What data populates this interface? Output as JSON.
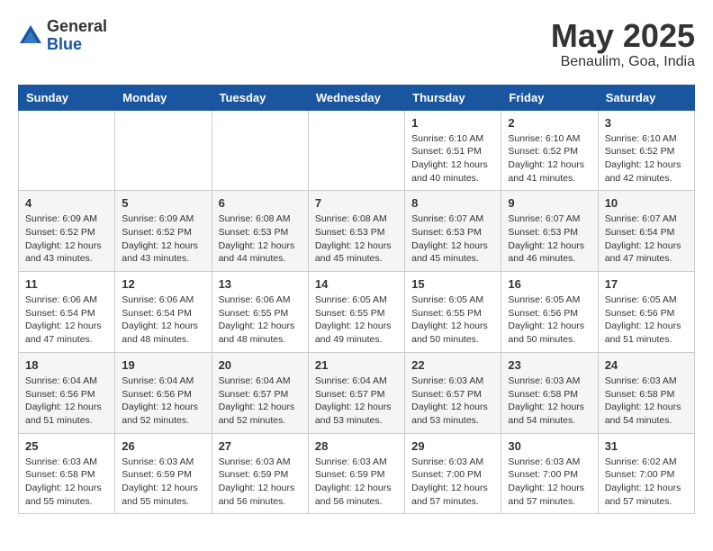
{
  "logo": {
    "general": "General",
    "blue": "Blue"
  },
  "title": {
    "month": "May 2025",
    "location": "Benaulim, Goa, India"
  },
  "headers": [
    "Sunday",
    "Monday",
    "Tuesday",
    "Wednesday",
    "Thursday",
    "Friday",
    "Saturday"
  ],
  "weeks": [
    [
      {
        "day": "",
        "info": ""
      },
      {
        "day": "",
        "info": ""
      },
      {
        "day": "",
        "info": ""
      },
      {
        "day": "",
        "info": ""
      },
      {
        "day": "1",
        "info": "Sunrise: 6:10 AM\nSunset: 6:51 PM\nDaylight: 12 hours\nand 40 minutes."
      },
      {
        "day": "2",
        "info": "Sunrise: 6:10 AM\nSunset: 6:52 PM\nDaylight: 12 hours\nand 41 minutes."
      },
      {
        "day": "3",
        "info": "Sunrise: 6:10 AM\nSunset: 6:52 PM\nDaylight: 12 hours\nand 42 minutes."
      }
    ],
    [
      {
        "day": "4",
        "info": "Sunrise: 6:09 AM\nSunset: 6:52 PM\nDaylight: 12 hours\nand 43 minutes."
      },
      {
        "day": "5",
        "info": "Sunrise: 6:09 AM\nSunset: 6:52 PM\nDaylight: 12 hours\nand 43 minutes."
      },
      {
        "day": "6",
        "info": "Sunrise: 6:08 AM\nSunset: 6:53 PM\nDaylight: 12 hours\nand 44 minutes."
      },
      {
        "day": "7",
        "info": "Sunrise: 6:08 AM\nSunset: 6:53 PM\nDaylight: 12 hours\nand 45 minutes."
      },
      {
        "day": "8",
        "info": "Sunrise: 6:07 AM\nSunset: 6:53 PM\nDaylight: 12 hours\nand 45 minutes."
      },
      {
        "day": "9",
        "info": "Sunrise: 6:07 AM\nSunset: 6:53 PM\nDaylight: 12 hours\nand 46 minutes."
      },
      {
        "day": "10",
        "info": "Sunrise: 6:07 AM\nSunset: 6:54 PM\nDaylight: 12 hours\nand 47 minutes."
      }
    ],
    [
      {
        "day": "11",
        "info": "Sunrise: 6:06 AM\nSunset: 6:54 PM\nDaylight: 12 hours\nand 47 minutes."
      },
      {
        "day": "12",
        "info": "Sunrise: 6:06 AM\nSunset: 6:54 PM\nDaylight: 12 hours\nand 48 minutes."
      },
      {
        "day": "13",
        "info": "Sunrise: 6:06 AM\nSunset: 6:55 PM\nDaylight: 12 hours\nand 48 minutes."
      },
      {
        "day": "14",
        "info": "Sunrise: 6:05 AM\nSunset: 6:55 PM\nDaylight: 12 hours\nand 49 minutes."
      },
      {
        "day": "15",
        "info": "Sunrise: 6:05 AM\nSunset: 6:55 PM\nDaylight: 12 hours\nand 50 minutes."
      },
      {
        "day": "16",
        "info": "Sunrise: 6:05 AM\nSunset: 6:56 PM\nDaylight: 12 hours\nand 50 minutes."
      },
      {
        "day": "17",
        "info": "Sunrise: 6:05 AM\nSunset: 6:56 PM\nDaylight: 12 hours\nand 51 minutes."
      }
    ],
    [
      {
        "day": "18",
        "info": "Sunrise: 6:04 AM\nSunset: 6:56 PM\nDaylight: 12 hours\nand 51 minutes."
      },
      {
        "day": "19",
        "info": "Sunrise: 6:04 AM\nSunset: 6:56 PM\nDaylight: 12 hours\nand 52 minutes."
      },
      {
        "day": "20",
        "info": "Sunrise: 6:04 AM\nSunset: 6:57 PM\nDaylight: 12 hours\nand 52 minutes."
      },
      {
        "day": "21",
        "info": "Sunrise: 6:04 AM\nSunset: 6:57 PM\nDaylight: 12 hours\nand 53 minutes."
      },
      {
        "day": "22",
        "info": "Sunrise: 6:03 AM\nSunset: 6:57 PM\nDaylight: 12 hours\nand 53 minutes."
      },
      {
        "day": "23",
        "info": "Sunrise: 6:03 AM\nSunset: 6:58 PM\nDaylight: 12 hours\nand 54 minutes."
      },
      {
        "day": "24",
        "info": "Sunrise: 6:03 AM\nSunset: 6:58 PM\nDaylight: 12 hours\nand 54 minutes."
      }
    ],
    [
      {
        "day": "25",
        "info": "Sunrise: 6:03 AM\nSunset: 6:58 PM\nDaylight: 12 hours\nand 55 minutes."
      },
      {
        "day": "26",
        "info": "Sunrise: 6:03 AM\nSunset: 6:59 PM\nDaylight: 12 hours\nand 55 minutes."
      },
      {
        "day": "27",
        "info": "Sunrise: 6:03 AM\nSunset: 6:59 PM\nDaylight: 12 hours\nand 56 minutes."
      },
      {
        "day": "28",
        "info": "Sunrise: 6:03 AM\nSunset: 6:59 PM\nDaylight: 12 hours\nand 56 minutes."
      },
      {
        "day": "29",
        "info": "Sunrise: 6:03 AM\nSunset: 7:00 PM\nDaylight: 12 hours\nand 57 minutes."
      },
      {
        "day": "30",
        "info": "Sunrise: 6:03 AM\nSunset: 7:00 PM\nDaylight: 12 hours\nand 57 minutes."
      },
      {
        "day": "31",
        "info": "Sunrise: 6:02 AM\nSunset: 7:00 PM\nDaylight: 12 hours\nand 57 minutes."
      }
    ]
  ]
}
